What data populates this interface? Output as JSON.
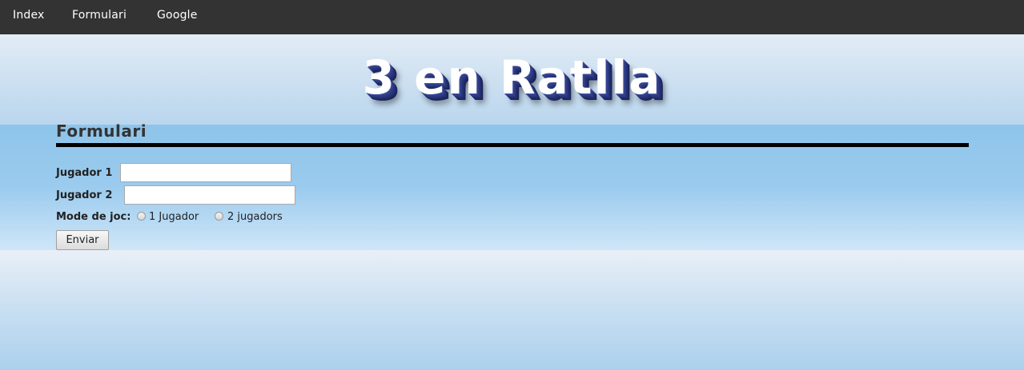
{
  "nav": {
    "items": [
      {
        "label": "Index"
      },
      {
        "label": "Formulari"
      },
      {
        "label": "Google"
      }
    ]
  },
  "header": {
    "title": "3 en Ratlla"
  },
  "section": {
    "title": "Formulari"
  },
  "form": {
    "player1_label": "Jugador 1",
    "player1_value": "",
    "player2_label": "Jugador 2",
    "player2_value": "",
    "mode_label": "Mode de joc:",
    "mode_options": [
      {
        "label": "1 Jugador",
        "selected": false
      },
      {
        "label": "2 jugadors",
        "selected": false
      }
    ],
    "submit_label": "Enviar"
  }
}
